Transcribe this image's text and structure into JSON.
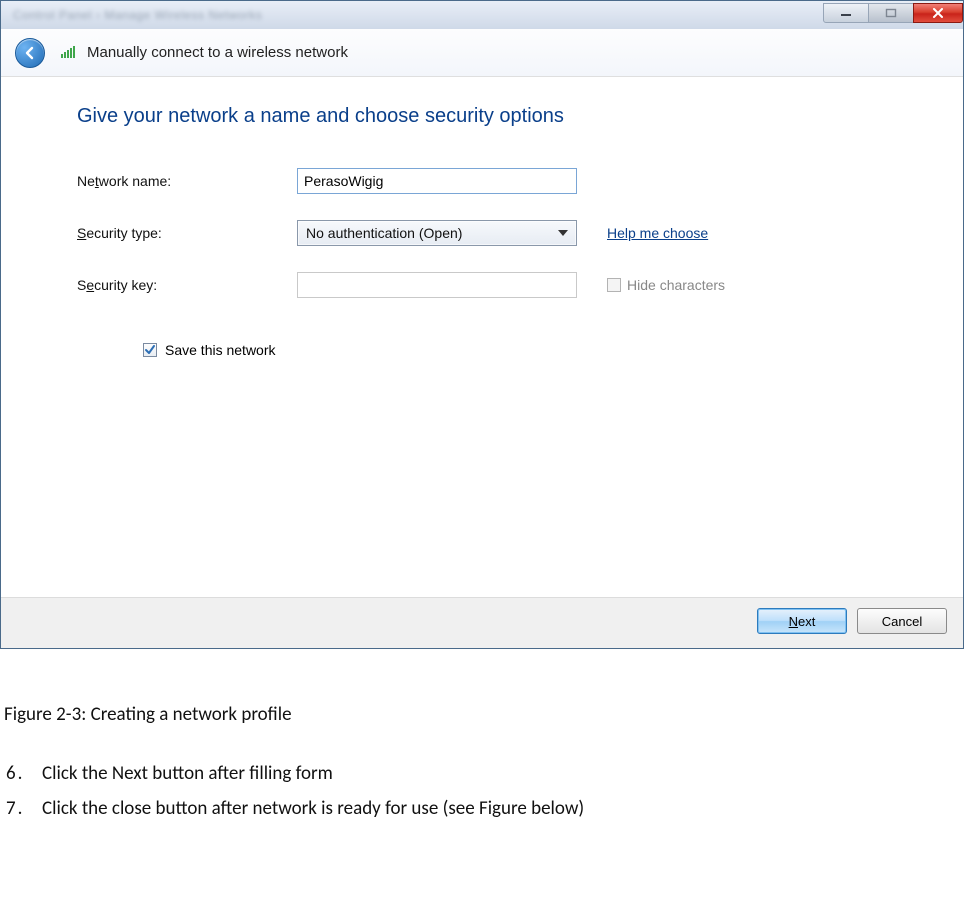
{
  "window": {
    "titlebar_blur": "Control Panel  ›  Manage Wireless Networks",
    "header_title": "Manually connect to a wireless network"
  },
  "content": {
    "heading": "Give your network a name and choose security options",
    "labels": {
      "network_name_pre": "Ne",
      "network_name_ul": "t",
      "network_name_post": "work name:",
      "security_type_ul": "S",
      "security_type_post": "ecurity type:",
      "security_key_pre": "S",
      "security_key_ul": "e",
      "security_key_post": "curity key:",
      "save_pre": "Sa",
      "save_ul": "v",
      "save_post": "e this network",
      "hide_ul": "H",
      "hide_post": "ide characters"
    },
    "network_name_value": "PerasoWigig",
    "security_type_value": "No authentication (Open)",
    "security_key_value": "",
    "help_link": "Help me choose",
    "save_checked": true,
    "hide_enabled": false
  },
  "footer": {
    "next_ul": "N",
    "next_post": "ext",
    "cancel": "Cancel"
  },
  "doc": {
    "caption": "Figure 2-3: Creating a network profile",
    "steps": [
      {
        "num": "6",
        "text": "Click the Next button after filling form"
      },
      {
        "num": "7",
        "text": "Click the close button after network is ready for use (see Figure below)"
      }
    ]
  }
}
